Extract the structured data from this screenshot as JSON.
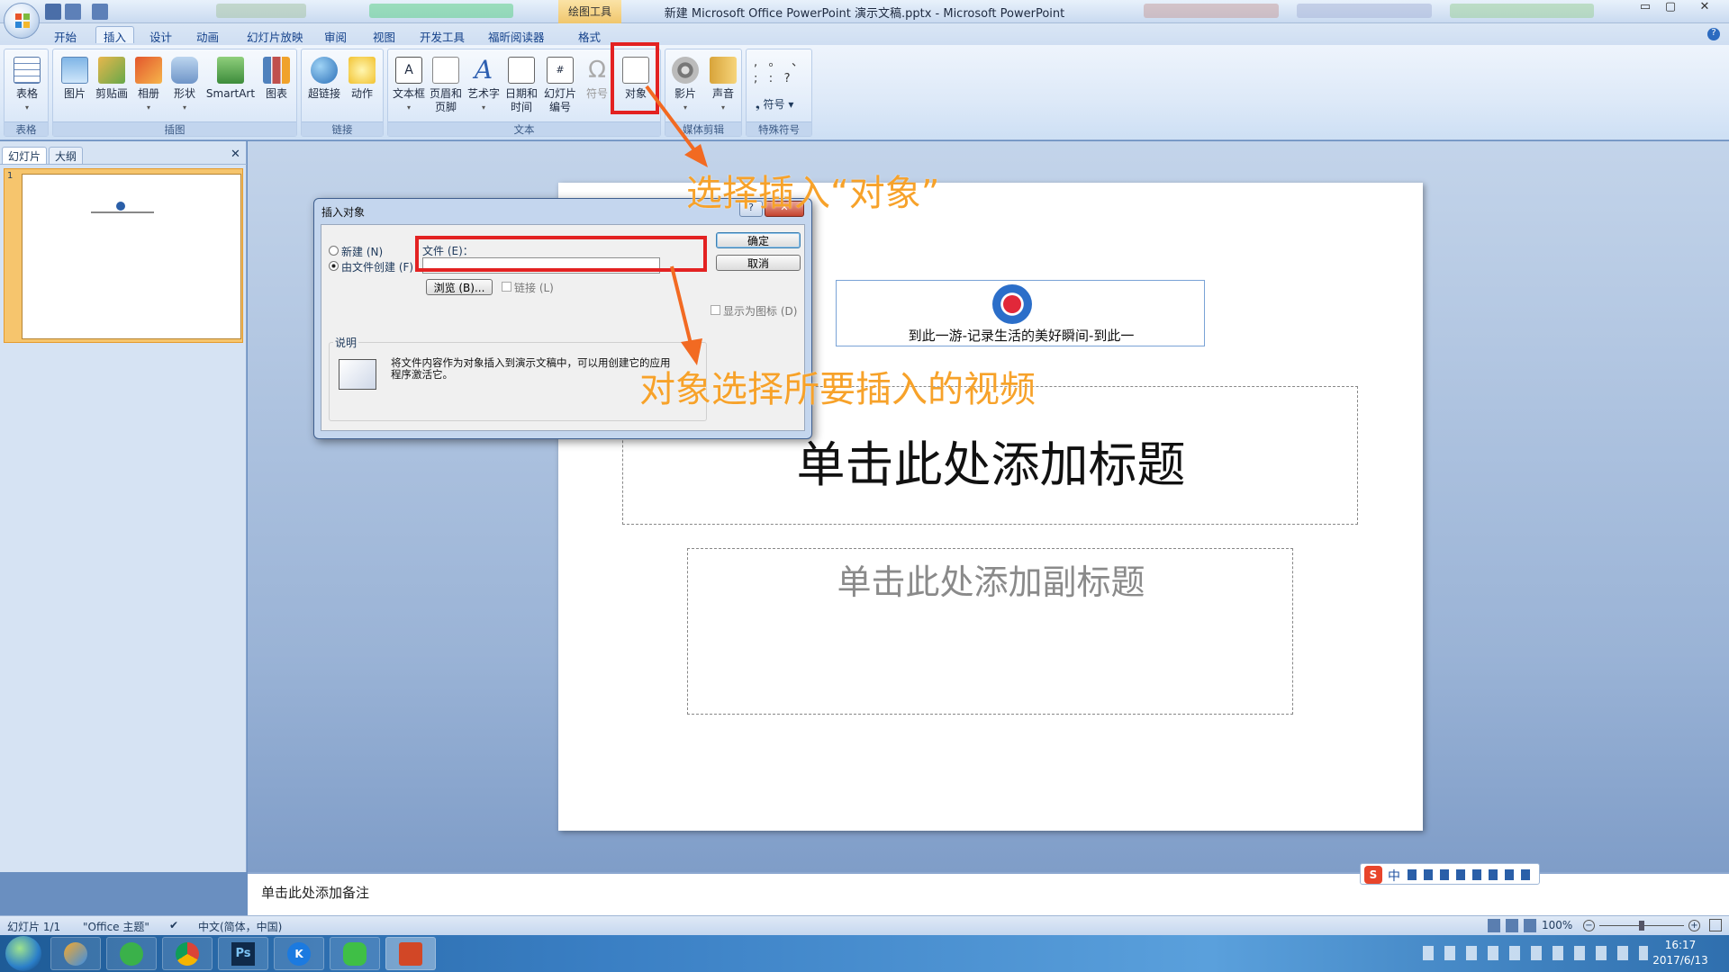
{
  "window": {
    "title": "新建 Microsoft Office PowerPoint 演示文稿.pptx - Microsoft PowerPoint",
    "context_tools": "绘图工具",
    "min": "▭",
    "max": "▢",
    "close": "✕"
  },
  "tabs": [
    "开始",
    "插入",
    "设计",
    "动画",
    "幻灯片放映",
    "审阅",
    "视图",
    "开发工具",
    "福昕阅读器",
    "格式"
  ],
  "ribbon": {
    "groups": [
      {
        "label": "表格"
      },
      {
        "label": "插图"
      },
      {
        "label": "链接"
      },
      {
        "label": "文本"
      },
      {
        "label": "媒体剪辑"
      },
      {
        "label": "特殊符号"
      }
    ],
    "buttons": {
      "table": "表格",
      "picture": "图片",
      "clipart": "剪贴画",
      "album": "相册",
      "shapes": "形状",
      "smartart": "SmartArt",
      "chart": "图表",
      "hyperlink": "超链接",
      "action": "动作",
      "textbox": "文本框",
      "header_l1": "页眉和",
      "header_l2": "页脚",
      "wordart": "艺术字",
      "datetime_l1": "日期和",
      "datetime_l2": "时间",
      "slidenum_l1": "幻灯片",
      "slidenum_l2": "编号",
      "symbol": "符号",
      "object": "对象",
      "movie": "影片",
      "sound": "声音",
      "special_symbol": "符号"
    },
    "special_chars": [
      ",",
      "。",
      "、",
      ";",
      ":",
      "?"
    ]
  },
  "pane": {
    "tab_slides": "幻灯片",
    "tab_outline": "大纲",
    "close": "✕",
    "slide_number": "1"
  },
  "slide": {
    "object_caption": "到此一游-记录生活的美好瞬间-到此一",
    "title_placeholder": "单击此处添加标题",
    "subtitle_placeholder": "单击此处添加副标题"
  },
  "notes": {
    "placeholder": "单击此处添加备注"
  },
  "status": {
    "slide": "幻灯片 1/1",
    "theme": "\"Office 主题\"",
    "language": "中文(简体，中国)",
    "zoom": "100%"
  },
  "ime": {
    "lang": "中"
  },
  "dialog": {
    "title": "插入对象",
    "help": "?",
    "close": "✕",
    "create_new": "新建 (N)",
    "create_from_file": "由文件创建 (F)",
    "file_label": "文件 (E)：",
    "file_value": "",
    "browse": "浏览 (B)...",
    "link": "链接 (L)",
    "display_as_icon": "显示为图标 (D)",
    "ok": "确定",
    "cancel": "取消",
    "desc_label": "说明",
    "description": "将文件内容作为对象插入到演示文稿中，可以用创建它的应用程序激活它。"
  },
  "annotations": {
    "step1": "选择插入“对象”",
    "step2": "对象选择所要插入的视频"
  },
  "clock": {
    "time": "16:17",
    "date": "2017/6/13"
  },
  "colors": {
    "accent": "#e32222",
    "annotation": "#f7a22a"
  }
}
